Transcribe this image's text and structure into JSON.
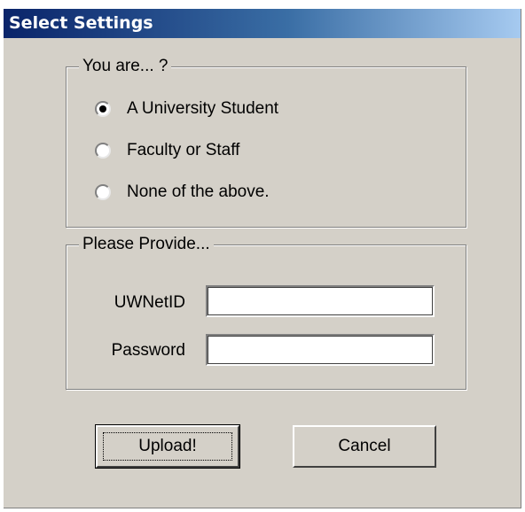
{
  "window": {
    "title": "Select Settings"
  },
  "role_group": {
    "legend": "You are... ?",
    "options": [
      {
        "label": "A University Student",
        "checked": true
      },
      {
        "label": "Faculty or Staff",
        "checked": false
      },
      {
        "label": "None of the above.",
        "checked": false
      }
    ]
  },
  "credentials_group": {
    "legend": "Please Provide...",
    "netid_label": "UWNetID",
    "netid_value": "",
    "password_label": "Password",
    "password_value": ""
  },
  "buttons": {
    "upload_label": "Upload!",
    "cancel_label": "Cancel"
  },
  "colors": {
    "dialog_face": "#d4d0c8",
    "titlebar_start": "#0a246a",
    "titlebar_end": "#a6caf0"
  }
}
